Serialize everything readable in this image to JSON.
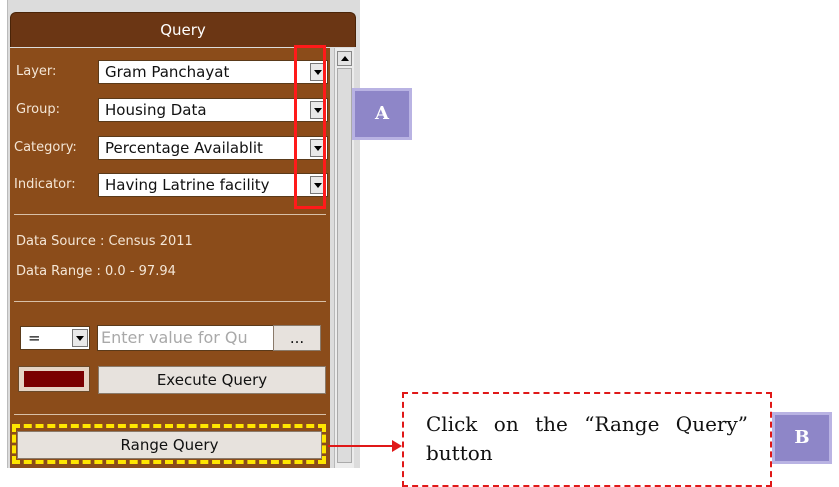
{
  "panel": {
    "title": "Query",
    "fields": [
      {
        "label": "Layer:",
        "value": "Gram Panchayat"
      },
      {
        "label": "Group:",
        "value": "Housing Data"
      },
      {
        "label": "Category:",
        "value": "Percentage Availablit"
      },
      {
        "label": "Indicator:",
        "value": "Having Latrine facility"
      }
    ],
    "data_source": "Data Source : Census 2011",
    "data_range": "Data Range : 0.0 - 97.94",
    "operator": "=",
    "query_placeholder": "Enter value for Qu",
    "browse_label": "...",
    "execute_label": "Execute Query",
    "range_query_label": "Range Query",
    "swatch_color": "#7a0000"
  },
  "annotations": {
    "tag_a": "A",
    "tag_b": "B",
    "note": "Click on the “Range Query” button"
  }
}
